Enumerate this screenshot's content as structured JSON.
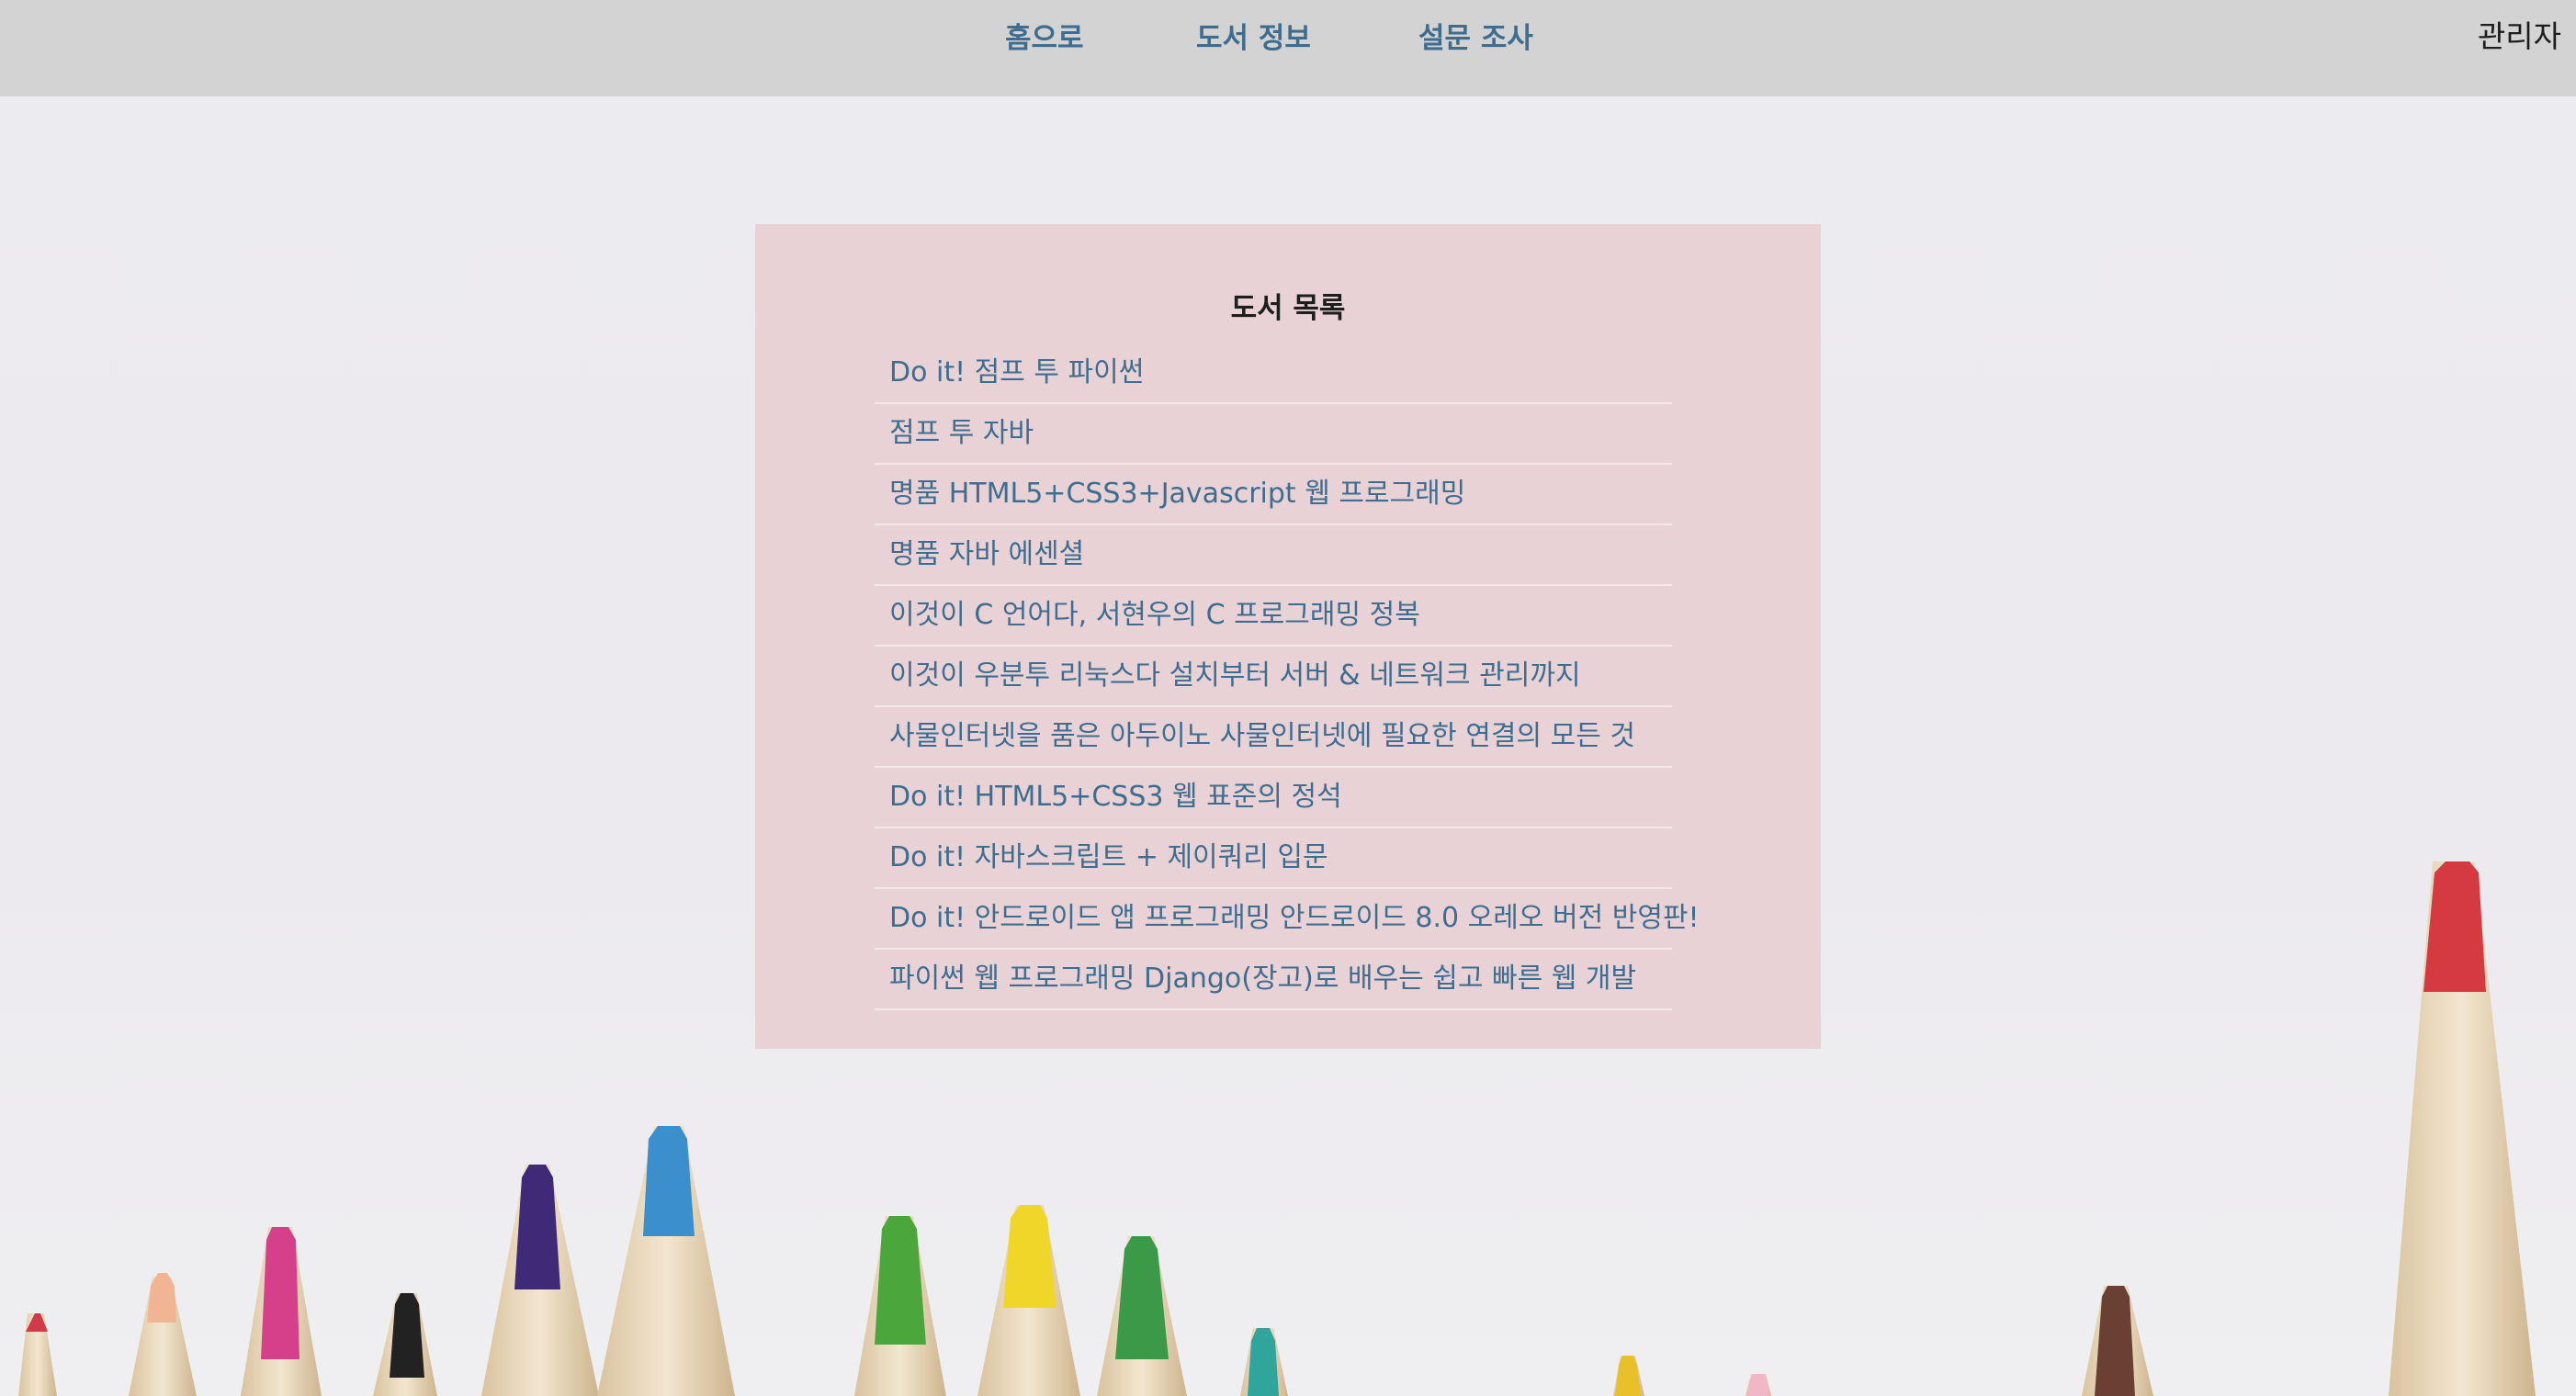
{
  "nav": {
    "home": "홈으로",
    "books": "도서 정보",
    "survey": "설문 조사",
    "admin": "관리자"
  },
  "book_list": {
    "title": "도서 목록",
    "items": [
      "Do it! 점프 투 파이썬",
      "점프 투 자바",
      "명품 HTML5+CSS3+Javascript 웹 프로그래밍",
      "명품 자바 에센셜",
      "이것이 C 언어다, 서현우의 C 프로그래밍 정복",
      "이것이 우분투 리눅스다 설치부터 서버 & 네트워크 관리까지",
      "사물인터넷을 품은 아두이노 사물인터넷에 필요한 연결의 모든 것",
      "Do it! HTML5+CSS3 웹 표준의 정석",
      "Do it! 자바스크립트 + 제이쿼리 입문",
      "Do it! 안드로이드 앱 프로그래밍 안드로이드 8.0 오레오 버전 반영판!",
      "파이썬 웹 프로그래밍 Django(장고)로 배우는 쉽고 빠른 웹 개발"
    ]
  },
  "colors": {
    "nav_bar": "#d3d3d4",
    "link": "#3e6d90",
    "panel": "#e8d2d5",
    "background": "#eceaee"
  }
}
